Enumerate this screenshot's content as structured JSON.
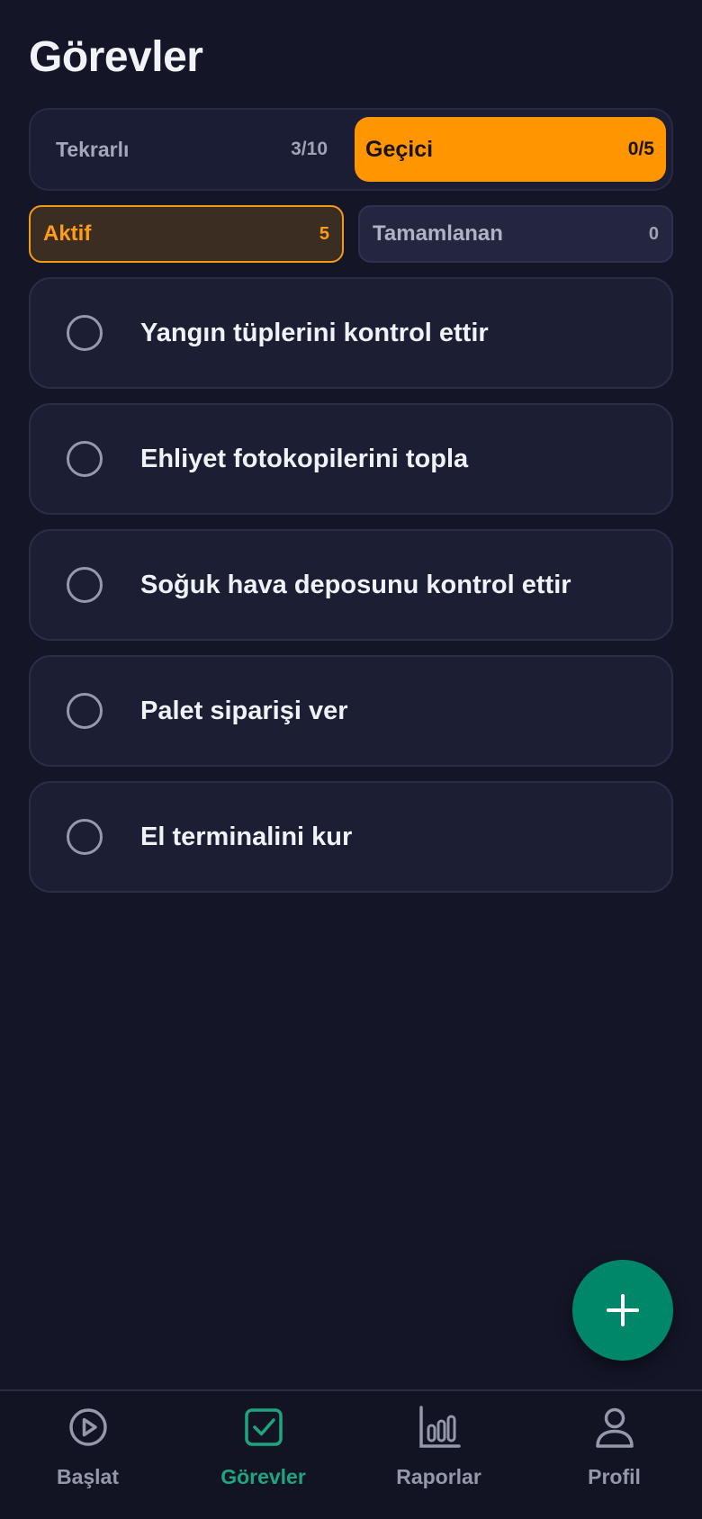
{
  "page": {
    "title": "Görevler"
  },
  "type_tabs": [
    {
      "label": "Tekrarlı",
      "count": "3/10",
      "selected": false
    },
    {
      "label": "Geçici",
      "count": "0/5",
      "selected": true
    }
  ],
  "status_filters": [
    {
      "label": "Aktif",
      "count": "5",
      "selected": true
    },
    {
      "label": "Tamamlanan",
      "count": "0",
      "selected": false
    }
  ],
  "tasks": [
    {
      "title": "Yangın tüplerini kontrol ettir",
      "done": false
    },
    {
      "title": "Ehliyet fotokopilerini topla",
      "done": false
    },
    {
      "title": "Soğuk hava deposunu kontrol ettir",
      "done": false
    },
    {
      "title": "Palet siparişi ver",
      "done": false
    },
    {
      "title": "El terminalini kur",
      "done": false
    }
  ],
  "fab": {
    "icon": "plus-icon"
  },
  "bottom_nav": [
    {
      "label": "Başlat",
      "icon": "play-circle-icon",
      "active": false
    },
    {
      "label": "Görevler",
      "icon": "checkbox-icon",
      "active": true
    },
    {
      "label": "Raporlar",
      "icon": "bar-chart-icon",
      "active": false
    },
    {
      "label": "Profil",
      "icon": "user-icon",
      "active": false
    }
  ],
  "colors": {
    "background": "#141628",
    "accent_orange": "#ff9500",
    "accent_green": "#00876a",
    "nav_active": "#1ea57f",
    "muted_text": "#9498ab"
  }
}
